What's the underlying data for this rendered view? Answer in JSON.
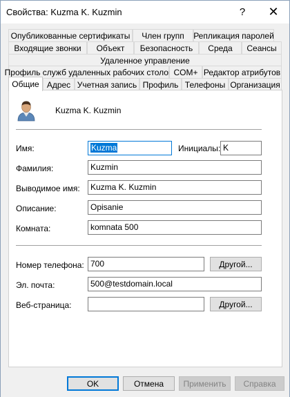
{
  "window": {
    "title": "Свойства: Kuzma K. Kuzmin",
    "help_label": "?",
    "close_label": "✕"
  },
  "tabs": {
    "row1": [
      "Опубликованные сертификаты",
      "Член групп",
      "Репликация паролей"
    ],
    "row2": [
      "Входящие звонки",
      "Объект",
      "Безопасность",
      "Среда",
      "Сеансы"
    ],
    "row3": [
      "Удаленное управление"
    ],
    "row4": [
      "Профиль служб удаленных рабочих столов",
      "COM+",
      "Редактор атрибутов"
    ],
    "row5": [
      "Общие",
      "Адрес",
      "Учетная запись",
      "Профиль",
      "Телефоны",
      "Организация"
    ],
    "active": "Общие"
  },
  "general": {
    "display_name": "Kuzma K. Kuzmin",
    "avatar_icon": "user-icon",
    "first_name_label": "Имя:",
    "first_name": "Kuzma",
    "initials_label": "Инициалы:",
    "initials": "K",
    "last_name_label": "Фамилия:",
    "last_name": "Kuzmin",
    "display_label": "Выводимое имя:",
    "display_value": "Kuzma K. Kuzmin",
    "description_label": "Описание:",
    "description": "Opisanie",
    "office_label": "Комната:",
    "office": "komnata 500",
    "phone_label": "Номер телефона:",
    "phone": "700",
    "phone_other": "Другой...",
    "email_label": "Эл. почта:",
    "email": "500@testdomain.local",
    "web_label": "Веб-страница:",
    "web": "",
    "web_other": "Другой..."
  },
  "buttons": {
    "ok": "OK",
    "cancel": "Отмена",
    "apply": "Применить",
    "help": "Справка"
  },
  "colors": {
    "accent": "#0078d7",
    "window_bg": "#f0f0f0",
    "panel_bg": "#ffffff"
  }
}
